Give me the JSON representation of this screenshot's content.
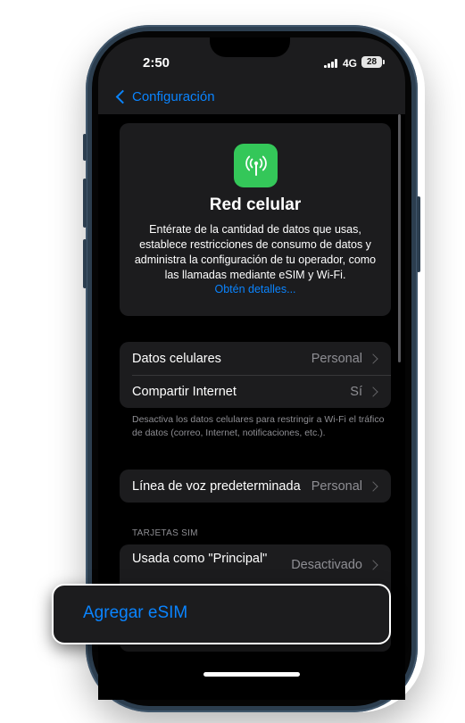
{
  "status_bar": {
    "time": "2:50",
    "network": "4G",
    "battery": "28"
  },
  "nav": {
    "back_label": "Configuración",
    "back_icon": "chevron-left-icon"
  },
  "info_card": {
    "icon": "cellular-antenna-icon",
    "icon_color": "#34c759",
    "title": "Red celular",
    "description": "Entérate de la cantidad de datos que usas, establece restricciones de consumo de datos y administra la configuración de tu operador, como las llamadas mediante eSIM y Wi-Fi.",
    "link": "Obtén detalles..."
  },
  "group1": {
    "rows": [
      {
        "label": "Datos celulares",
        "value": "Personal"
      },
      {
        "label": "Compartir Internet",
        "value": "Sí"
      }
    ],
    "footnote": "Desactiva los datos celulares para restringir a Wi-Fi el tráfico de datos (correo, Internet, notificaciones, etc.)."
  },
  "group2": {
    "rows": [
      {
        "label": "Línea de voz predeterminada",
        "value": "Personal"
      }
    ]
  },
  "sim_section": {
    "header": "TARJETAS SIM",
    "rows": [
      {
        "label": "Usada como \"Principal\"",
        "value": "Desactivado"
      }
    ]
  },
  "esim_button": {
    "label": "Agregar eSIM"
  },
  "colors": {
    "accent": "#0a84ff",
    "background": "#000000",
    "cell": "#1c1c1e",
    "frame": "#2c3e4f"
  }
}
